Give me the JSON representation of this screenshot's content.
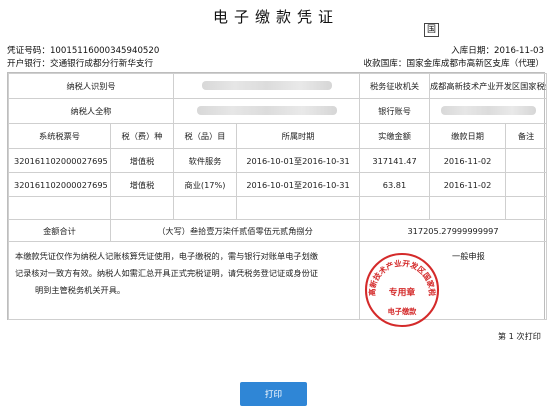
{
  "document": {
    "title": "电子缴款凭证",
    "corner_mark": "国"
  },
  "header": {
    "voucher_no": "凭证号码：10015116000345940520",
    "date": "入库日期：2016-11-03",
    "bank": "开户银行：交通银行成都分行新华支行",
    "treasury": "收款国库：国家金库成都市高新区支库（代理）"
  },
  "info": {
    "taxpayer_id_label": "纳税人识别号",
    "tax_office_label": "税务征收机关",
    "tax_office_value": "成都高新技术产业开发区国家税务局",
    "taxpayer_name_label": "纳税人全称",
    "bank_account_label": "银行账号"
  },
  "table": {
    "headers": [
      "系统税票号",
      "税（费）种",
      "税（品）目",
      "所属时期",
      "实缴金额",
      "缴款日期",
      "备注"
    ],
    "rows": [
      [
        "320161102000027695",
        "增值税",
        "软件服务",
        "2016-10-01至2016-10-31",
        "317141.47",
        "2016-11-02",
        ""
      ],
      [
        "320161102000027695",
        "增值税",
        "商业(17%)",
        "2016-10-01至2016-10-31",
        "63.81",
        "2016-11-02",
        ""
      ]
    ]
  },
  "total": {
    "label": "金额合计",
    "amount_words": "（大写）叁拾壹万柒仟贰佰零伍元贰角捌分",
    "amount": "317205.27999999997"
  },
  "note": {
    "lines": [
      "本缴款凭证仅作为纳税人记账核算凭证使用，电子缴税的，需与银行对账单电子划缴",
      "记录核对一致方有效。纳税人如需汇总开具正式完税证明，请凭税务登记证或身份证",
      "明到主管税务机关开具。"
    ],
    "declare_type": "一般申报"
  },
  "seal": {
    "outer_text": "成都高新技术产业开发区国家税务局",
    "center_text": "专用章",
    "bottom_text": "电子缴款",
    "color": "#d42a2a"
  },
  "footer": {
    "print_count": "第 1 次打印",
    "print_button": "打印"
  },
  "colors": {
    "print_button": "#2f86d6",
    "border": "#cfcfcf"
  }
}
